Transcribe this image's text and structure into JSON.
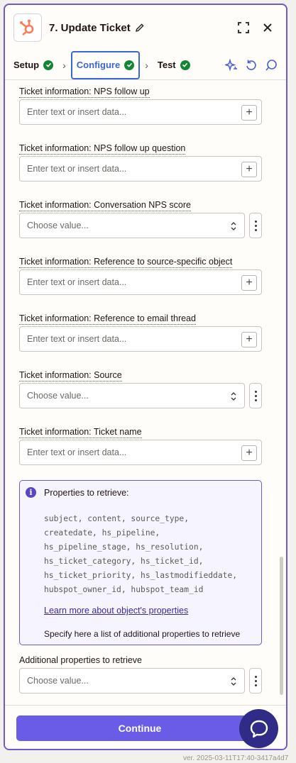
{
  "header": {
    "title": "7. Update Ticket",
    "app_icon": "hubspot-logo",
    "brand_color": "#ff7a59"
  },
  "tabs": [
    {
      "label": "Setup",
      "status": "complete"
    },
    {
      "label": "Configure",
      "status": "complete",
      "active": true
    },
    {
      "label": "Test",
      "status": "complete"
    }
  ],
  "fields": [
    {
      "label": "Ticket information: NPS follow up",
      "type": "text",
      "placeholder": "Enter text or insert data..."
    },
    {
      "label": "Ticket information: NPS follow up question",
      "type": "text",
      "placeholder": "Enter text or insert data..."
    },
    {
      "label": "Ticket information: Conversation NPS score",
      "type": "select",
      "placeholder": "Choose value..."
    },
    {
      "label": "Ticket information: Reference to source-specific object",
      "type": "text",
      "placeholder": "Enter text or insert data..."
    },
    {
      "label": "Ticket information: Reference to email thread",
      "type": "text",
      "placeholder": "Enter text or insert data..."
    },
    {
      "label": "Ticket information: Source",
      "type": "select",
      "placeholder": "Choose value..."
    },
    {
      "label": "Ticket information: Ticket name",
      "type": "text",
      "placeholder": "Enter text or insert data..."
    }
  ],
  "info_box": {
    "title": "Properties to retrieve:",
    "code_lines": [
      "subject, content, source_type,",
      "createdate, hs_pipeline,",
      "hs_pipeline_stage, hs_resolution,",
      "hs_ticket_category, hs_ticket_id,",
      "hs_ticket_priority, hs_lastmodifieddate,",
      "hubspot_owner_id, hubspot_team_id"
    ],
    "link": "Learn more about object's properties",
    "note": "Specify here a list of additional properties to retrieve"
  },
  "additional": {
    "label": "Additional properties to retrieve",
    "placeholder": "Choose value..."
  },
  "footer": {
    "continue_label": "Continue"
  },
  "version": "ver. 2025-03-11T17:40-3417a4d7",
  "colors": {
    "accent": "#6a5ce6",
    "success": "#138636",
    "active_tab": "#3a66d9"
  }
}
